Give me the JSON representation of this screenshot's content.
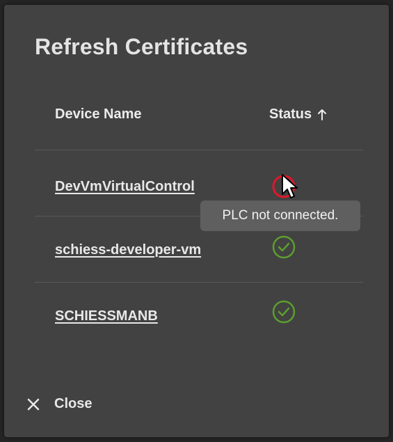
{
  "dialog": {
    "title": "Refresh Certificates",
    "close_label": "Close"
  },
  "table": {
    "columns": [
      {
        "label": "Device Name"
      },
      {
        "label": "Status",
        "sort": "ascending",
        "sort_icon": "arrow-up-icon"
      }
    ],
    "rows": [
      {
        "device": "DevVmVirtualControl",
        "status": "error",
        "status_icon": "error-circle-icon"
      },
      {
        "device": "schiess-developer-vm",
        "status": "ok",
        "status_icon": "check-circle-icon"
      },
      {
        "device": "SCHIESSMANB",
        "status": "ok",
        "status_icon": "check-circle-icon"
      }
    ]
  },
  "tooltip": {
    "text": "PLC not connected."
  },
  "colors": {
    "dialog_bg": "#424242",
    "text": "#e8e8e8",
    "ok": "#5c9e2f",
    "error": "#e0172a",
    "tooltip_bg": "#5f5f5f"
  }
}
